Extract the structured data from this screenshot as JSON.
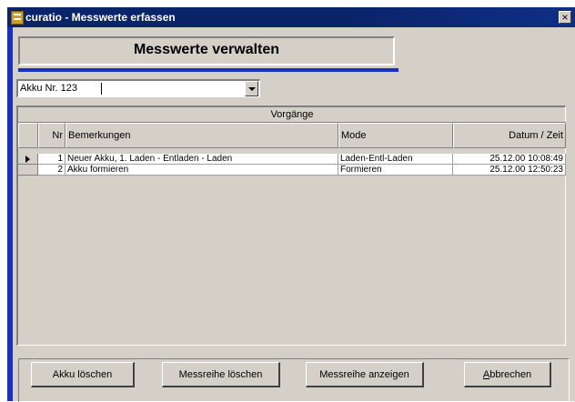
{
  "window": {
    "title": "curatio - Messwerte erfassen",
    "close_label": "×"
  },
  "form": {
    "header": "Messwerte verwalten"
  },
  "combo": {
    "value": "Akku Nr. 123"
  },
  "subform": {
    "caption": "Vorgänge",
    "columns": {
      "nr": "Nr",
      "bemerkungen": "Bemerkungen",
      "mode": "Mode",
      "datum": "Datum / Zeit"
    },
    "rows": [
      {
        "nr": "1",
        "bemerkungen": "Neuer Akku, 1. Laden - Entladen - Laden",
        "mode": "Laden-Entl-Laden",
        "datum": "25.12.00 10:08:49"
      },
      {
        "nr": "2",
        "bemerkungen": "Akku formieren",
        "mode": "Formieren",
        "datum": "25.12.00 12:50:23"
      }
    ]
  },
  "buttons": {
    "akku_loeschen": "Akku löschen",
    "messreihe_loeschen": "Messreihe löschen",
    "messreihe_anzeigen": "Messreihe anzeigen",
    "abbrechen_first": "A",
    "abbrechen_rest": "bbrechen"
  },
  "colors": {
    "titlebar": "#0a246a",
    "accent_line": "#1a2fc0",
    "face": "#d4d0c8"
  }
}
